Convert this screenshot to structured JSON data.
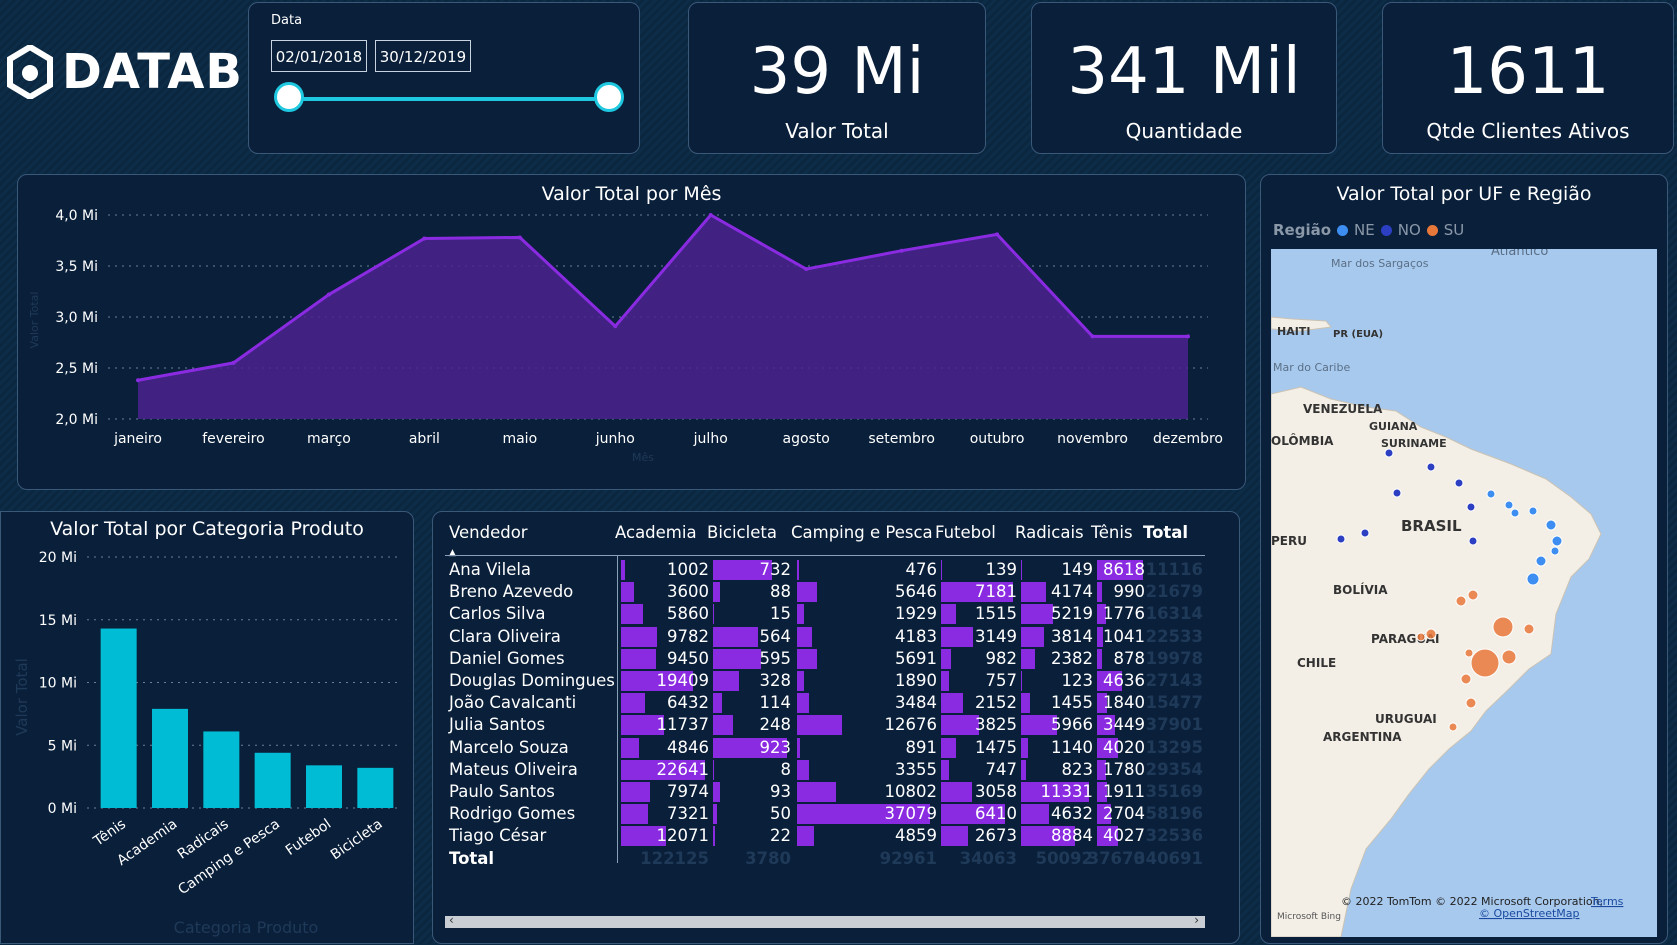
{
  "brand": {
    "name": "DATAB"
  },
  "filter": {
    "label": "Data",
    "start": "02/01/2018",
    "end": "30/12/2019"
  },
  "kpis": [
    {
      "value": "39 Mi",
      "label": "Valor Total"
    },
    {
      "value": "341 Mil",
      "label": "Quantidade"
    },
    {
      "value": "1611",
      "label": "Qtde Clientes Ativos"
    }
  ],
  "month_chart": {
    "title": "Valor Total por Mês",
    "ylabel": "Valor Total",
    "xlabel": "Mês",
    "line_color": "#8a2be2",
    "fill_color": "#4b2390"
  },
  "category_chart": {
    "title": "Valor Total por Categoria Produto",
    "ylabel": "Valor Total",
    "xlabel": "Categoria Produto",
    "bar_color": "#00bcd4"
  },
  "chart_data": [
    {
      "type": "area",
      "title": "Valor Total por Mês",
      "xlabel": "Mês",
      "ylabel": "Valor Total",
      "categories": [
        "janeiro",
        "fevereiro",
        "março",
        "abril",
        "maio",
        "junho",
        "julho",
        "agosto",
        "setembro",
        "outubro",
        "novembro",
        "dezembro"
      ],
      "values": [
        2.38,
        2.55,
        3.22,
        3.77,
        3.78,
        2.91,
        4.0,
        3.47,
        3.65,
        3.81,
        2.81,
        2.81
      ],
      "ylim": [
        2.0,
        4.0
      ],
      "yticks": [
        "2,0 Mi",
        "2,5 Mi",
        "3,0 Mi",
        "3,5 Mi",
        "4,0 Mi"
      ],
      "grid": true
    },
    {
      "type": "bar",
      "title": "Valor Total por Categoria Produto",
      "xlabel": "Categoria Produto",
      "ylabel": "Valor Total",
      "categories": [
        "Tênis",
        "Academia",
        "Radicais",
        "Camping e Pesca",
        "Futebol",
        "Bicicleta"
      ],
      "values": [
        14.3,
        7.9,
        6.1,
        4.4,
        3.4,
        3.2
      ],
      "ylim": [
        0,
        20
      ],
      "yticks": [
        "0 Mi",
        "5 Mi",
        "10 Mi",
        "15 Mi",
        "20 Mi"
      ],
      "grid": true
    }
  ],
  "table": {
    "headers": [
      "Vendedor",
      "Academia",
      "Bicicleta",
      "Camping e Pesca",
      "Futebol",
      "Radicais",
      "Tênis",
      "Total"
    ],
    "rows": [
      {
        "name": "Ana Vilela",
        "v": [
          "1002",
          "732",
          "476",
          "139",
          "149",
          "8618",
          "11116"
        ]
      },
      {
        "name": "Breno Azevedo",
        "v": [
          "3600",
          "88",
          "5646",
          "7181",
          "4174",
          "990",
          "21679"
        ]
      },
      {
        "name": "Carlos Silva",
        "v": [
          "5860",
          "15",
          "1929",
          "1515",
          "5219",
          "1776",
          "16314"
        ]
      },
      {
        "name": "Clara Oliveira",
        "v": [
          "9782",
          "564",
          "4183",
          "3149",
          "3814",
          "1041",
          "22533"
        ]
      },
      {
        "name": "Daniel Gomes",
        "v": [
          "9450",
          "595",
          "5691",
          "982",
          "2382",
          "878",
          "19978"
        ]
      },
      {
        "name": "Douglas Domingues",
        "v": [
          "19409",
          "328",
          "1890",
          "757",
          "123",
          "4636",
          "27143"
        ]
      },
      {
        "name": "João Cavalcanti",
        "v": [
          "6432",
          "114",
          "3484",
          "2152",
          "1455",
          "1840",
          "15477"
        ]
      },
      {
        "name": "Julia Santos",
        "v": [
          "11737",
          "248",
          "12676",
          "3825",
          "5966",
          "3449",
          "37901"
        ]
      },
      {
        "name": "Marcelo Souza",
        "v": [
          "4846",
          "923",
          "891",
          "1475",
          "1140",
          "4020",
          "13295"
        ]
      },
      {
        "name": "Mateus Oliveira",
        "v": [
          "22641",
          "8",
          "3355",
          "747",
          "823",
          "1780",
          "29354"
        ]
      },
      {
        "name": "Paulo Santos",
        "v": [
          "7974",
          "93",
          "10802",
          "3058",
          "11331",
          "1911",
          "35169"
        ]
      },
      {
        "name": "Rodrigo Gomes",
        "v": [
          "7321",
          "50",
          "37079",
          "6410",
          "4632",
          "2704",
          "58196"
        ]
      },
      {
        "name": "Tiago César",
        "v": [
          "12071",
          "22",
          "4859",
          "2673",
          "8884",
          "4027",
          "32536"
        ]
      }
    ],
    "total": {
      "name": "Total",
      "v": [
        "122125",
        "3780",
        "92961",
        "34063",
        "50092",
        "37670",
        "340691"
      ]
    },
    "bar_color": "#8a2be2"
  },
  "map": {
    "title": "Valor Total por UF e Região",
    "legend_title": "Região",
    "legend": [
      {
        "name": "NE",
        "color": "#3d8ef0"
      },
      {
        "name": "NO",
        "color": "#2c3fc2"
      },
      {
        "name": "SU",
        "color": "#e8773a"
      }
    ],
    "labels": [
      "Atlântico",
      "Mar dos Sargaços",
      "HAITI",
      "PR (EUA)",
      "Mar do Caribe",
      "VENEZUELA",
      "GUIANA",
      "SURINAME",
      "OLÔMBIA",
      "BRASIL",
      "PERU",
      "BOLÍVIA",
      "PARAGUAI",
      "CHILE",
      "URUGUAI",
      "ARGENTINA"
    ],
    "attribution": "© 2022 TomTom © 2022 Microsoft Corporation,",
    "terms": "Terms",
    "osm": "© OpenStreetMap",
    "bing": "Microsoft Bing"
  }
}
